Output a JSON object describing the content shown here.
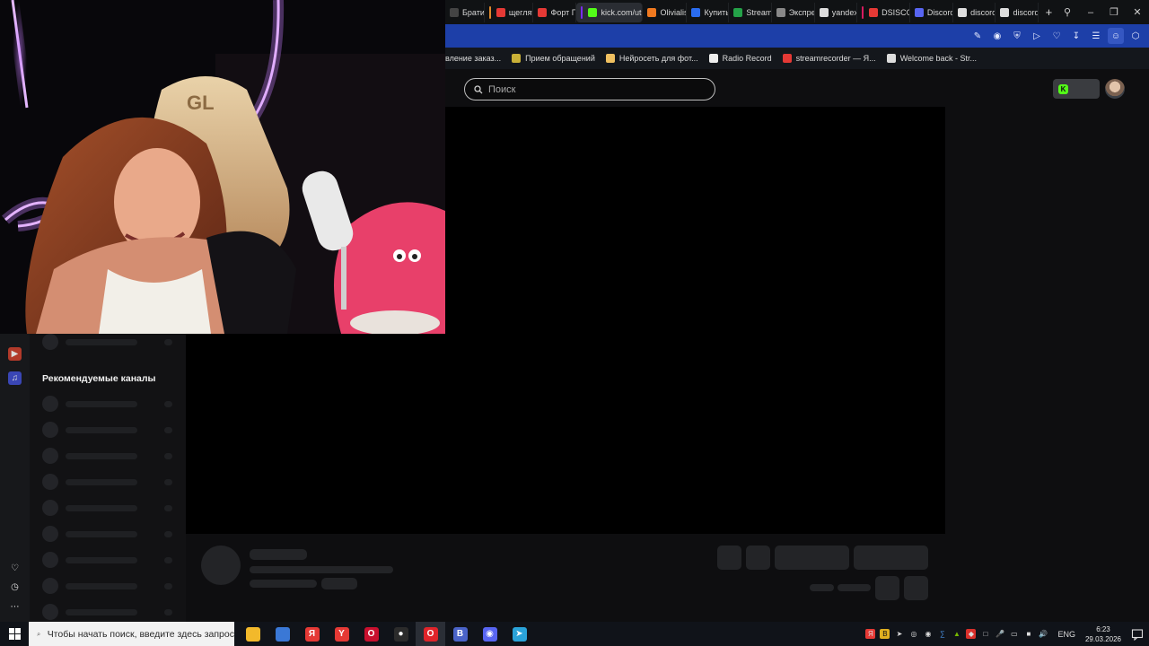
{
  "browser": {
    "tabs": [
      {
        "title": "Брати",
        "icon": "tab-page-icon",
        "color": "#444"
      },
      {
        "title": "щеглят",
        "icon": "yandex-icon",
        "color": "#e53935",
        "mark": "#e08a2c"
      },
      {
        "title": "Форт П",
        "icon": "map-pin-icon",
        "color": "#e53935"
      },
      {
        "title": "kick.com/utec",
        "icon": "kick-icon",
        "color": "#53fc18",
        "mark": "#7b2cf2",
        "active": true
      },
      {
        "title": "Olivialis",
        "icon": "boosty-icon",
        "color": "#f0791f"
      },
      {
        "title": "Купить",
        "icon": "f-icon",
        "color": "#2a6cf0"
      },
      {
        "title": "Stream",
        "icon": "stream-icon",
        "color": "#24a148"
      },
      {
        "title": "Экспре",
        "icon": "grid-icon",
        "color": "#888"
      },
      {
        "title": "yandex",
        "icon": "doc-icon",
        "color": "#ddd"
      },
      {
        "title": "DSISCO",
        "icon": "yandex-icon",
        "color": "#e53935",
        "mark": "#d81b60"
      },
      {
        "title": "Discorc",
        "icon": "discord-icon",
        "color": "#5865f2"
      },
      {
        "title": "discord",
        "icon": "doc-icon",
        "color": "#ddd"
      },
      {
        "title": "discord",
        "icon": "doc-icon",
        "color": "#ddd"
      }
    ],
    "new_tab_label": "+",
    "bookmarks": [
      {
        "title": "вление заказ...",
        "icon": "none"
      },
      {
        "title": "Прием обращений",
        "icon": "star-icon",
        "color": "#c9b037"
      },
      {
        "title": "Нейросеть для фот...",
        "icon": "image-icon",
        "color": "#f0c060"
      },
      {
        "title": "Radio Record",
        "icon": "record-icon",
        "color": "#eee"
      },
      {
        "title": "streamrecorder — Я...",
        "icon": "yandex-icon",
        "color": "#e53935"
      },
      {
        "title": "Welcome back - Str...",
        "icon": "doc-icon",
        "color": "#ddd"
      }
    ]
  },
  "page": {
    "search_placeholder": "Поиск",
    "recommended_title": "Рекомендуемые каналы",
    "accent_color": "#53fc18"
  },
  "taskbar": {
    "search_placeholder": "Чтобы начать поиск, введите здесь запрос",
    "apps": [
      {
        "name": "file-explorer-icon",
        "color": "#f2b92b",
        "glyph": ""
      },
      {
        "name": "store-icon",
        "color": "#3a78d6",
        "glyph": ""
      },
      {
        "name": "yandex-icon",
        "color": "#e53935",
        "glyph": "Я"
      },
      {
        "name": "yandex-browser-icon",
        "color": "#e53935",
        "glyph": "Y"
      },
      {
        "name": "opera-icon",
        "color": "#c8102e",
        "glyph": "O"
      },
      {
        "name": "obs-icon",
        "color": "#2b2b2b",
        "glyph": "●"
      },
      {
        "name": "opera-gx-icon",
        "color": "#e0242a",
        "glyph": "O",
        "active": true
      },
      {
        "name": "vk-icon",
        "color": "#4a63c8",
        "glyph": "В"
      },
      {
        "name": "discord-icon",
        "color": "#5865f2",
        "glyph": "◉"
      },
      {
        "name": "telegram-icon",
        "color": "#2aa3d9",
        "glyph": "➤"
      }
    ],
    "language": "ENG",
    "time": "6:23",
    "date": "29.03.2026"
  }
}
